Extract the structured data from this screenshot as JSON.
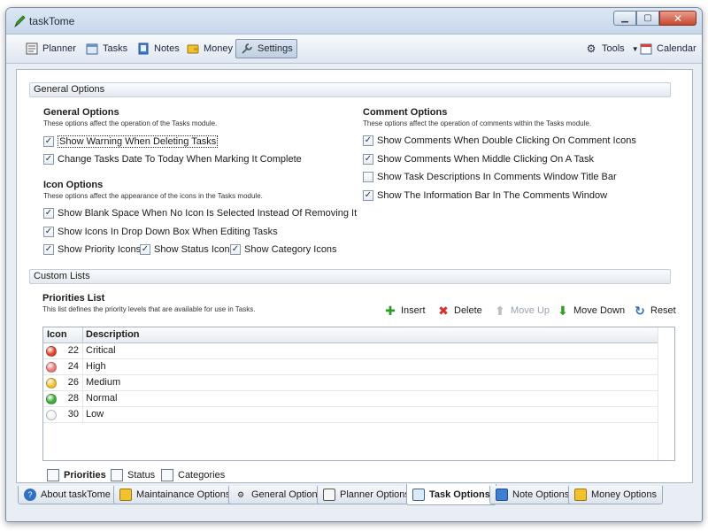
{
  "window": {
    "title": "taskTome"
  },
  "toolbar": {
    "planner": "Planner",
    "tasks": "Tasks",
    "notes": "Notes",
    "money": "Money",
    "settings": "Settings",
    "tools": "Tools",
    "calendar": "Calendar"
  },
  "sections": {
    "general": "General Options",
    "custom": "Custom Lists"
  },
  "general_options": {
    "title": "General Options",
    "desc": "These options affect the operation of the Tasks module.",
    "items": [
      {
        "label": "Show Warning When Deleting Tasks",
        "checked": true
      },
      {
        "label": "Change Tasks Date To Today When Marking It Complete",
        "checked": true
      }
    ]
  },
  "icon_options": {
    "title": "Icon Options",
    "desc": "These options affect the appearance of the icons in the Tasks module.",
    "items": [
      {
        "label": "Show Blank Space When No Icon Is Selected Instead Of Removing It",
        "checked": true
      },
      {
        "label": "Show Icons In Drop Down Box When Editing Tasks",
        "checked": true
      },
      {
        "label": "Show Priority Icons",
        "checked": true
      },
      {
        "label": "Show Status Icons",
        "checked": true
      },
      {
        "label": "Show Category Icons",
        "checked": true
      }
    ]
  },
  "comment_options": {
    "title": "Comment Options",
    "desc": "These options affect the operation of comments within the Tasks module.",
    "items": [
      {
        "label": "Show Comments When Double Clicking On Comment Icons",
        "checked": true
      },
      {
        "label": "Show Comments When Middle Clicking On A Task",
        "checked": true
      },
      {
        "label": "Show Task Descriptions In Comments Window Title Bar",
        "checked": false
      },
      {
        "label": "Show The Information Bar In The Comments Window",
        "checked": true
      }
    ]
  },
  "priorities": {
    "title": "Priorities List",
    "desc": "This list defines the priority levels that are available for use in Tasks.",
    "actions": {
      "insert": "Insert",
      "delete": "Delete",
      "move_up": "Move Up",
      "move_down": "Move Down",
      "reset": "Reset"
    },
    "columns": [
      "Icon",
      "Description"
    ],
    "rows": [
      {
        "icon": "red-circle",
        "color": "#e0442c",
        "num": "22",
        "desc": "Critical"
      },
      {
        "icon": "pink-circle",
        "color": "#f07a78",
        "num": "24",
        "desc": "High"
      },
      {
        "icon": "yellow-circle",
        "color": "#f2c12e",
        "num": "26",
        "desc": "Medium"
      },
      {
        "icon": "green-circle",
        "color": "#3fae3a",
        "num": "28",
        "desc": "Normal"
      },
      {
        "icon": "white-circle",
        "color": "#f3f3f3",
        "num": "30",
        "desc": "Low"
      }
    ]
  },
  "subtabs": [
    "Priorities",
    "Status",
    "Categories"
  ],
  "bottom_tabs": [
    "About taskTome",
    "Maintainance Options",
    "General Options",
    "Planner Options",
    "Task Options",
    "Note Options",
    "Money Options"
  ],
  "checkmark": "✓"
}
